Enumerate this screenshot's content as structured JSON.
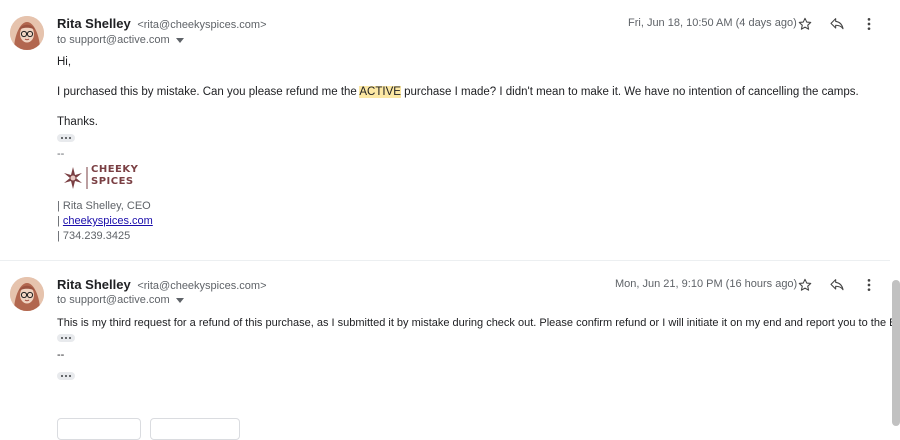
{
  "messages": [
    {
      "sender_name": "Rita Shelley",
      "sender_email": "<rita@cheekyspices.com>",
      "to_line": "to support@active.com",
      "date": "Fri, Jun 18, 10:50 AM (4 days ago)",
      "greeting": "Hi,",
      "body_before": "I purchased this by mistake. Can you please refund me the ",
      "body_highlight": "ACTIVE",
      "body_after": " purchase I made? I didn't mean to make it. We have no intention of cancelling the camps.",
      "closing": "Thanks.",
      "sig_dash": "--",
      "sig_name": "| Rita Shelley, CEO",
      "sig_link_prefix": "| ",
      "sig_link": "cheekyspices.com",
      "sig_phone": "| 734.239.3425",
      "logo_text": "CHEEKY SPICES"
    },
    {
      "sender_name": "Rita Shelley",
      "sender_email": "<rita@cheekyspices.com>",
      "to_line": "to support@active.com",
      "date": "Mon, Jun 21, 9:10 PM (16 hours ago)",
      "body": "This is my third request for a refund of this purchase, as I submitted it by mistake during check out. Please confirm refund or I will initiate it on my end and report you to the BBB.",
      "sig_dash": "--"
    }
  ],
  "icons": [
    "avatar",
    "caret-down-icon",
    "star-icon",
    "reply-icon",
    "more-vert-icon",
    "ellipsis-icon",
    "logo"
  ]
}
